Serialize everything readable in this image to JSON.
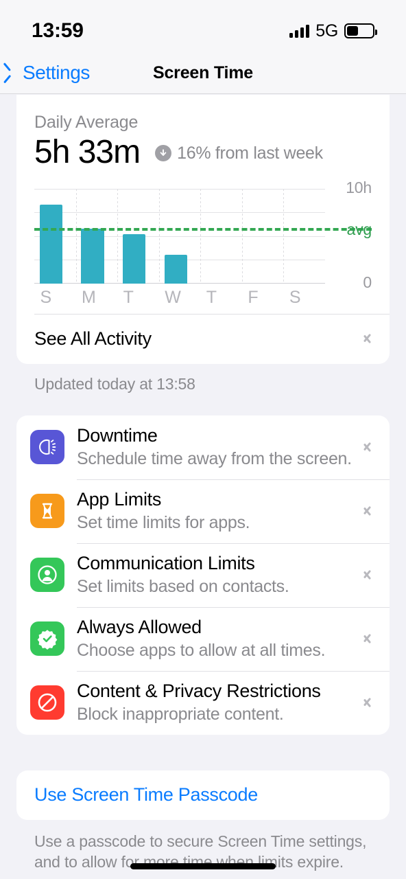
{
  "status_bar": {
    "time": "13:59",
    "network": "5G",
    "signal_icon": "cellular-bars-icon",
    "battery_icon": "battery-icon",
    "battery_percent": 40
  },
  "nav": {
    "back_label": "Settings",
    "back_icon": "chevron-left-icon",
    "title": "Screen Time"
  },
  "summary": {
    "label": "Daily Average",
    "value": "5h 33m",
    "delta_icon": "arrow-down-circle-icon",
    "delta_text": "16% from last week"
  },
  "chart_data": {
    "type": "bar",
    "title": "Daily Average",
    "categories": [
      "S",
      "M",
      "T",
      "W",
      "T",
      "F",
      "S"
    ],
    "values": [
      8.3,
      5.8,
      5.2,
      3.0,
      null,
      null,
      null
    ],
    "xlabel": "",
    "ylabel": "",
    "ylim": [
      0,
      10
    ],
    "ytick_labels": [
      "10h",
      "0"
    ],
    "grid": true,
    "unit": "hours",
    "average_line": {
      "value": 5.55,
      "label": "avg",
      "color": "#34a853",
      "style": "dashed"
    },
    "bar_color": "#31aec3",
    "legend": "none"
  },
  "activity_row": {
    "label": "See All Activity",
    "chevron_icon": "chevron-right-icon"
  },
  "updated_caption": "Updated today at 13:58",
  "settings_rows": [
    {
      "title": "Downtime",
      "subtitle": "Schedule time away from the screen.",
      "icon": "downtime-icon",
      "icon_color": "#5856d6",
      "chevron_icon": "chevron-right-icon"
    },
    {
      "title": "App Limits",
      "subtitle": "Set time limits for apps.",
      "icon": "hourglass-icon",
      "icon_color": "#f79a1b",
      "chevron_icon": "chevron-right-icon"
    },
    {
      "title": "Communication Limits",
      "subtitle": "Set limits based on contacts.",
      "icon": "person-circle-icon",
      "icon_color": "#34c759",
      "chevron_icon": "chevron-right-icon"
    },
    {
      "title": "Always Allowed",
      "subtitle": "Choose apps to allow at all times.",
      "icon": "checkmark-seal-icon",
      "icon_color": "#34c759",
      "chevron_icon": "chevron-right-icon"
    },
    {
      "title": "Content & Privacy Restrictions",
      "subtitle": "Block inappropriate content.",
      "icon": "no-entry-icon",
      "icon_color": "#ff3b30",
      "chevron_icon": "chevron-right-icon"
    }
  ],
  "passcode": {
    "link_label": "Use Screen Time Passcode",
    "caption": "Use a passcode to secure Screen Time settings, and to allow for more time when limits expire."
  }
}
